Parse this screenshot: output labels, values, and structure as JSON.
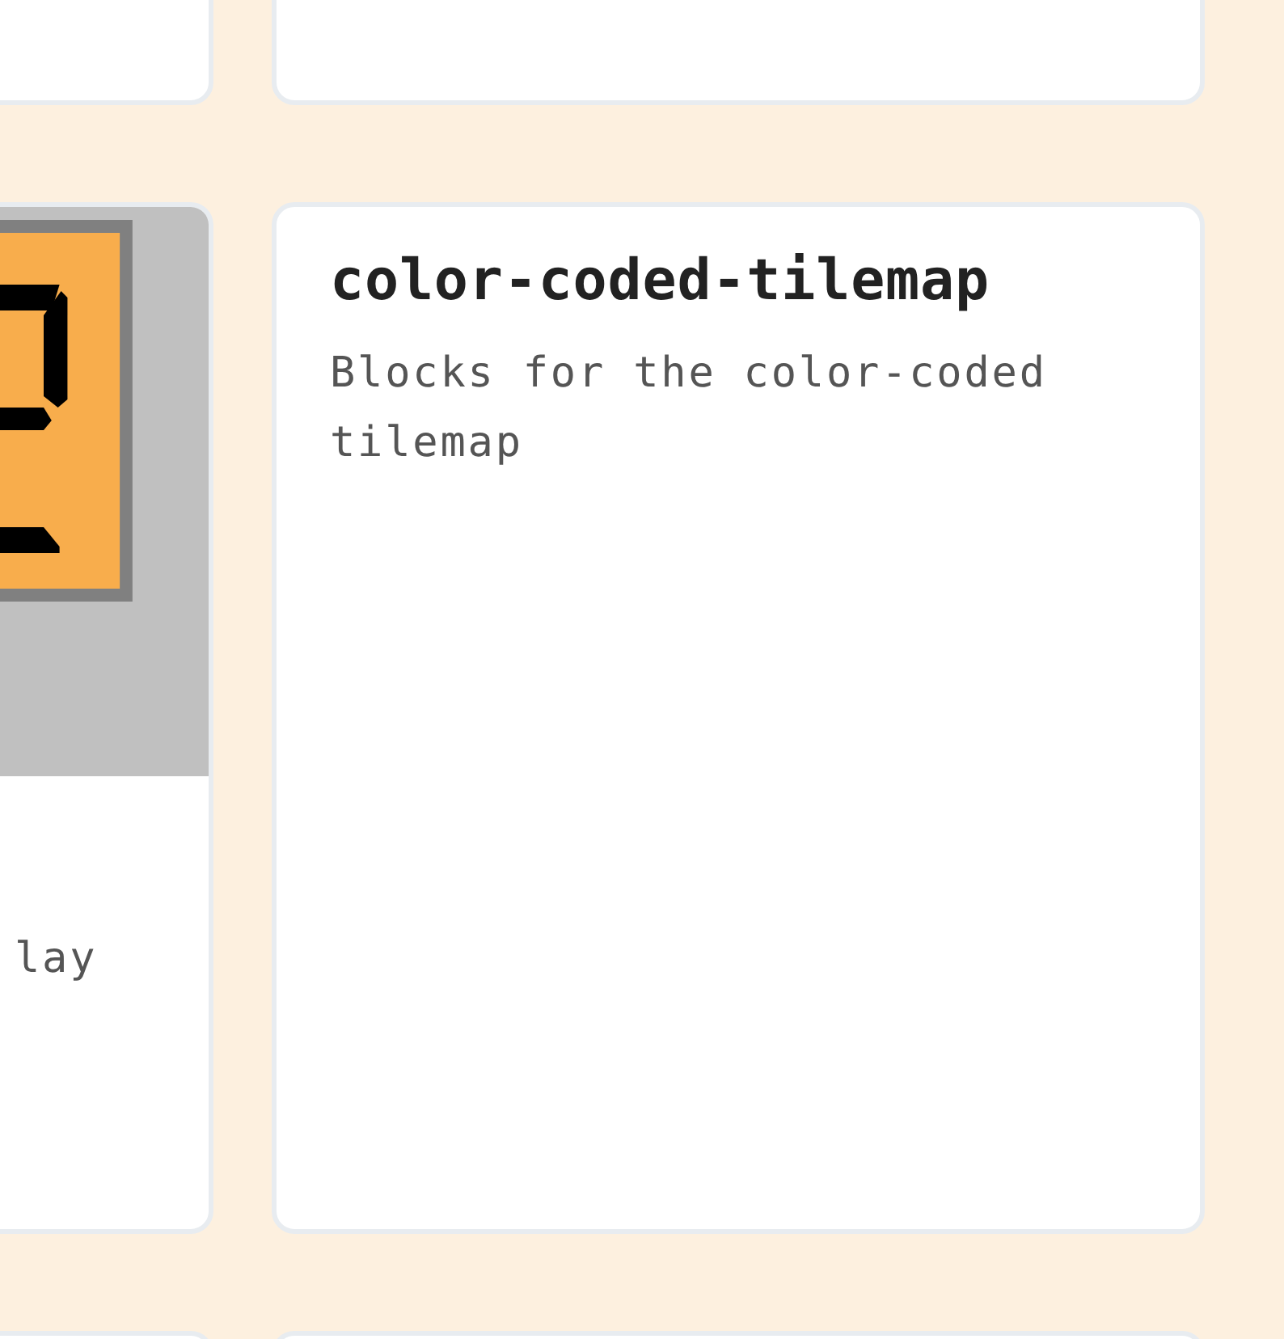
{
  "cards": [
    {
      "kind": "blank"
    },
    {
      "kind": "blank"
    },
    {
      "kind": "picture",
      "description": "lay"
    },
    {
      "kind": "text",
      "title": "color-coded-tilemap",
      "description": "Blocks for the color-coded tilemap"
    },
    {
      "kind": "blank"
    },
    {
      "kind": "blank"
    }
  ]
}
